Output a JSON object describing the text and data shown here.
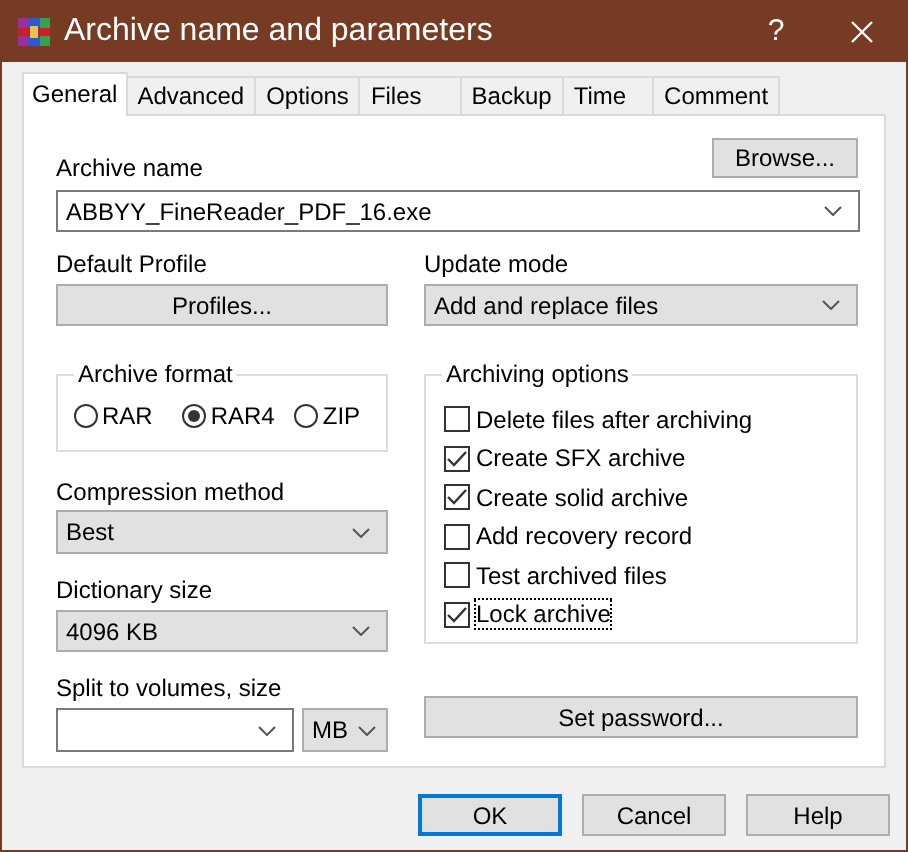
{
  "window": {
    "title": "Archive name and parameters",
    "help_button": "?"
  },
  "tabs": [
    {
      "label": "General",
      "selected": true
    },
    {
      "label": "Advanced",
      "selected": false
    },
    {
      "label": "Options",
      "selected": false
    },
    {
      "label": "Files",
      "selected": false
    },
    {
      "label": "Backup",
      "selected": false
    },
    {
      "label": "Time",
      "selected": false
    },
    {
      "label": "Comment",
      "selected": false
    }
  ],
  "archive_name": {
    "label": "Archive name",
    "value": "ABBYY_FineReader_PDF_16.exe",
    "browse_button": "Browse..."
  },
  "default_profile": {
    "label": "Default Profile",
    "button": "Profiles..."
  },
  "update_mode": {
    "label": "Update mode",
    "value": "Add and replace files"
  },
  "archive_format": {
    "title": "Archive format",
    "options": [
      {
        "label": "RAR",
        "selected": false
      },
      {
        "label": "RAR4",
        "selected": true
      },
      {
        "label": "ZIP",
        "selected": false
      }
    ]
  },
  "compression_method": {
    "label": "Compression method",
    "value": "Best"
  },
  "dictionary_size": {
    "label": "Dictionary size",
    "value": "4096 KB"
  },
  "split_volumes": {
    "label": "Split to volumes, size",
    "unit": "MB"
  },
  "archiving_options": {
    "title": "Archiving options",
    "items": [
      {
        "label": "Delete files after archiving",
        "checked": false,
        "focused": false
      },
      {
        "label": "Create SFX archive",
        "checked": true,
        "focused": false
      },
      {
        "label": "Create solid archive",
        "checked": true,
        "focused": false
      },
      {
        "label": "Add recovery record",
        "checked": false,
        "focused": false
      },
      {
        "label": "Test archived files",
        "checked": false,
        "focused": false
      },
      {
        "label": "Lock archive",
        "checked": true,
        "focused": true
      }
    ]
  },
  "set_password_button": "Set password...",
  "buttons": [
    {
      "label": "OK",
      "default": true
    },
    {
      "label": "Cancel",
      "default": false
    },
    {
      "label": "Help",
      "default": false
    }
  ]
}
